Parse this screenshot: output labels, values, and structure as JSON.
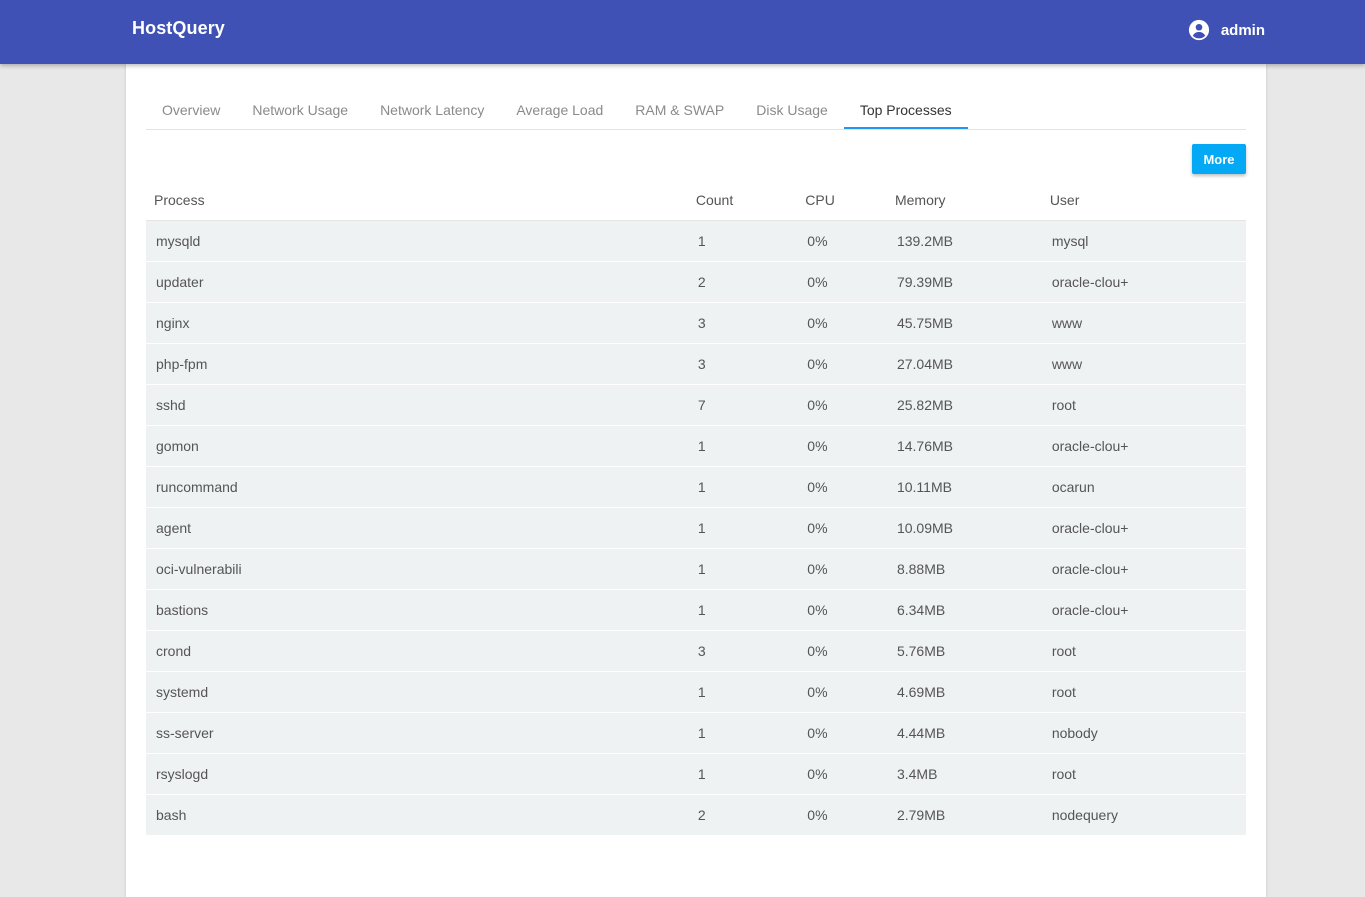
{
  "app": {
    "title": "HostQuery",
    "user": "admin",
    "user_icon": "account-circle-icon",
    "accent": "#3f51b5"
  },
  "tabs": [
    {
      "label": "Overview",
      "active": false
    },
    {
      "label": "Network Usage",
      "active": false
    },
    {
      "label": "Network Latency",
      "active": false
    },
    {
      "label": "Average Load",
      "active": false
    },
    {
      "label": "RAM & SWAP",
      "active": false
    },
    {
      "label": "Disk Usage",
      "active": false
    },
    {
      "label": "Top Processes",
      "active": true
    }
  ],
  "more_button": "More",
  "table": {
    "headers": [
      "Process",
      "Count",
      "CPU",
      "Memory",
      "User"
    ],
    "rows": [
      [
        "mysqld",
        "1",
        "0%",
        "139.2MB",
        "mysql"
      ],
      [
        "updater",
        "2",
        "0%",
        "79.39MB",
        "oracle-clou+"
      ],
      [
        "nginx",
        "3",
        "0%",
        "45.75MB",
        "www"
      ],
      [
        "php-fpm",
        "3",
        "0%",
        "27.04MB",
        "www"
      ],
      [
        "sshd",
        "7",
        "0%",
        "25.82MB",
        "root"
      ],
      [
        "gomon",
        "1",
        "0%",
        "14.76MB",
        "oracle-clou+"
      ],
      [
        "runcommand",
        "1",
        "0%",
        "10.11MB",
        "ocarun"
      ],
      [
        "agent",
        "1",
        "0%",
        "10.09MB",
        "oracle-clou+"
      ],
      [
        "oci-vulnerabili",
        "1",
        "0%",
        "8.88MB",
        "oracle-clou+"
      ],
      [
        "bastions",
        "1",
        "0%",
        "6.34MB",
        "oracle-clou+"
      ],
      [
        "crond",
        "3",
        "0%",
        "5.76MB",
        "root"
      ],
      [
        "systemd",
        "1",
        "0%",
        "4.69MB",
        "root"
      ],
      [
        "ss-server",
        "1",
        "0%",
        "4.44MB",
        "nobody"
      ],
      [
        "rsyslogd",
        "1",
        "0%",
        "3.4MB",
        "root"
      ],
      [
        "bash",
        "2",
        "0%",
        "2.79MB",
        "nodequery"
      ]
    ]
  }
}
